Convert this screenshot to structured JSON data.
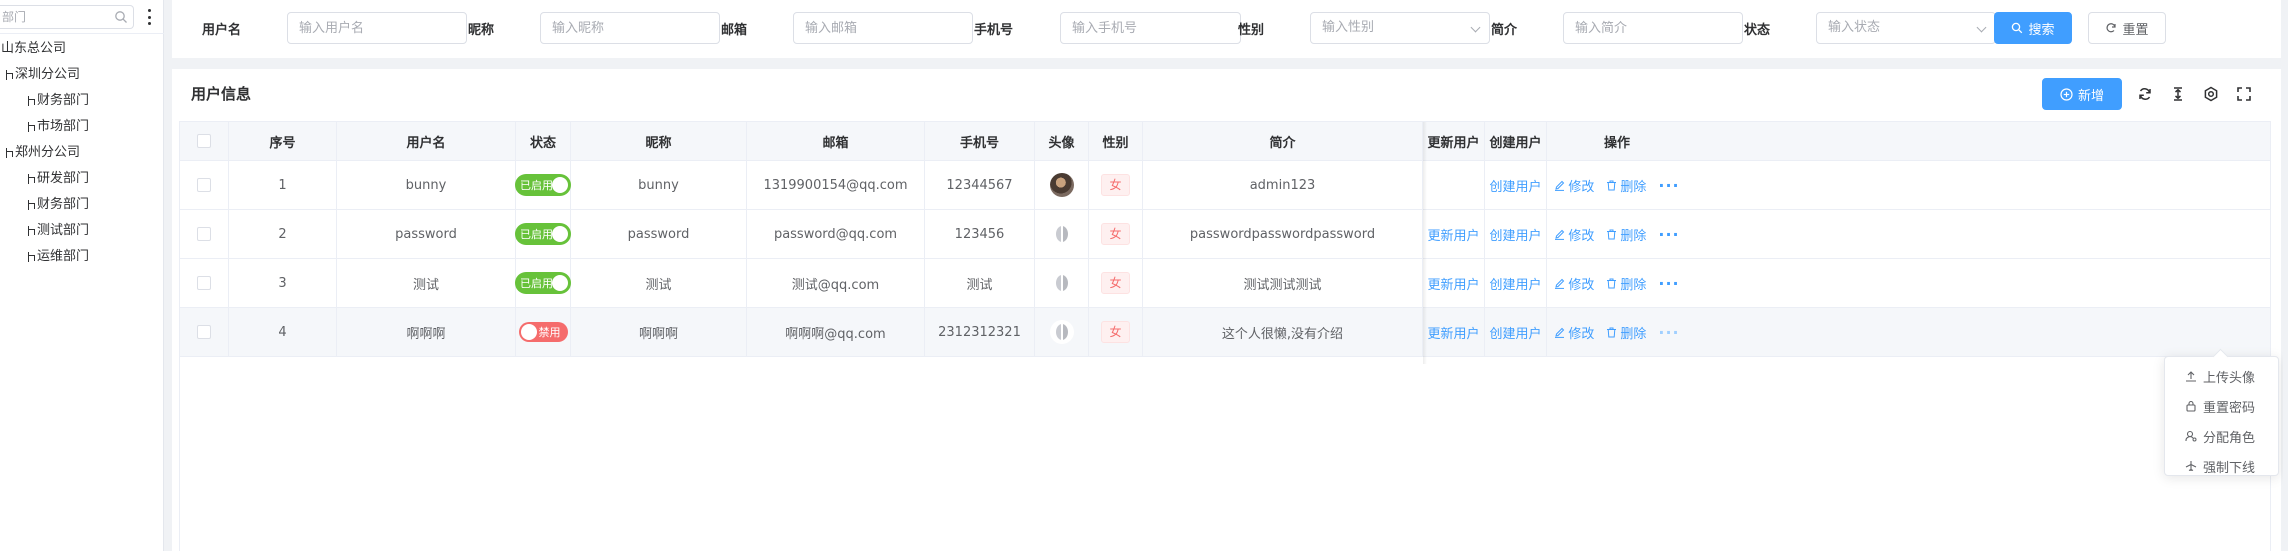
{
  "sidebar": {
    "search_placeholder": "部门",
    "tree": [
      {
        "label": "山东总公司",
        "level": 0,
        "branch": false
      },
      {
        "label": "深圳分公司",
        "level": 1,
        "branch": true
      },
      {
        "label": "财务部门",
        "level": 2,
        "branch": true
      },
      {
        "label": "市场部门",
        "level": 2,
        "branch": true
      },
      {
        "label": "郑州分公司",
        "level": 1,
        "branch": true
      },
      {
        "label": "研发部门",
        "level": 2,
        "branch": true
      },
      {
        "label": "财务部门",
        "level": 2,
        "branch": true
      },
      {
        "label": "测试部门",
        "level": 2,
        "branch": true
      },
      {
        "label": "运维部门",
        "level": 2,
        "branch": true
      }
    ]
  },
  "filters": {
    "username": {
      "label": "用户名",
      "placeholder": "输入用户名"
    },
    "nickname": {
      "label": "昵称",
      "placeholder": "输入昵称"
    },
    "email": {
      "label": "邮箱",
      "placeholder": "输入邮箱"
    },
    "phone": {
      "label": "手机号",
      "placeholder": "输入手机号"
    },
    "gender": {
      "label": "性别",
      "placeholder": "输入性别"
    },
    "intro": {
      "label": "简介",
      "placeholder": "输入简介"
    },
    "status": {
      "label": "状态",
      "placeholder": "输入状态"
    },
    "search_button": "搜索",
    "reset_button": "重置"
  },
  "panel": {
    "title": "用户信息",
    "add_button": "新增"
  },
  "table": {
    "headers": {
      "index": "序号",
      "username": "用户名",
      "status": "状态",
      "nickname": "昵称",
      "email": "邮箱",
      "phone": "手机号",
      "avatar": "头像",
      "gender": "性别",
      "intro": "简介",
      "update_user": "更新用户",
      "create_user": "创建用户",
      "actions": "操作"
    },
    "rows": [
      {
        "index": "1",
        "username": "bunny",
        "status": "已启用",
        "nickname": "bunny",
        "email": "1319900154@qq.com",
        "phone": "12344567",
        "gender": "女",
        "intro": "admin123",
        "update_user": "",
        "create_user": "创建用户",
        "edit": "修改",
        "delete": "删除"
      },
      {
        "index": "2",
        "username": "password",
        "status": "已启用",
        "nickname": "password",
        "email": "password@qq.com",
        "phone": "123456",
        "gender": "女",
        "intro": "passwordpasswordpassword",
        "update_user": "更新用户",
        "create_user": "创建用户",
        "edit": "修改",
        "delete": "删除"
      },
      {
        "index": "3",
        "username": "测试",
        "status": "已启用",
        "nickname": "测试",
        "email": "测试@qq.com",
        "phone": "测试",
        "gender": "女",
        "intro": "测试测试测试",
        "update_user": "更新用户",
        "create_user": "创建用户",
        "edit": "修改",
        "delete": "删除"
      },
      {
        "index": "4",
        "username": "啊啊啊",
        "status": "禁用",
        "nickname": "啊啊啊",
        "email": "啊啊啊@qq.com",
        "phone": "2312312321",
        "gender": "女",
        "intro": "这个人很懒,没有介绍",
        "update_user": "更新用户",
        "create_user": "创建用户",
        "edit": "修改",
        "delete": "删除"
      }
    ],
    "status_on": [
      true,
      true,
      true,
      false
    ],
    "avatar_type": [
      "photo",
      "default",
      "default",
      "default"
    ]
  },
  "more_menu": {
    "items": [
      {
        "label": "上传头像",
        "icon": "upload-icon"
      },
      {
        "label": "重置密码",
        "icon": "lock-icon"
      },
      {
        "label": "分配角色",
        "icon": "user-role-icon"
      },
      {
        "label": "强制下线",
        "icon": "airplane-icon"
      }
    ]
  },
  "colors": {
    "primary": "#409eff",
    "success": "#67c23a",
    "danger": "#f56c6c"
  }
}
